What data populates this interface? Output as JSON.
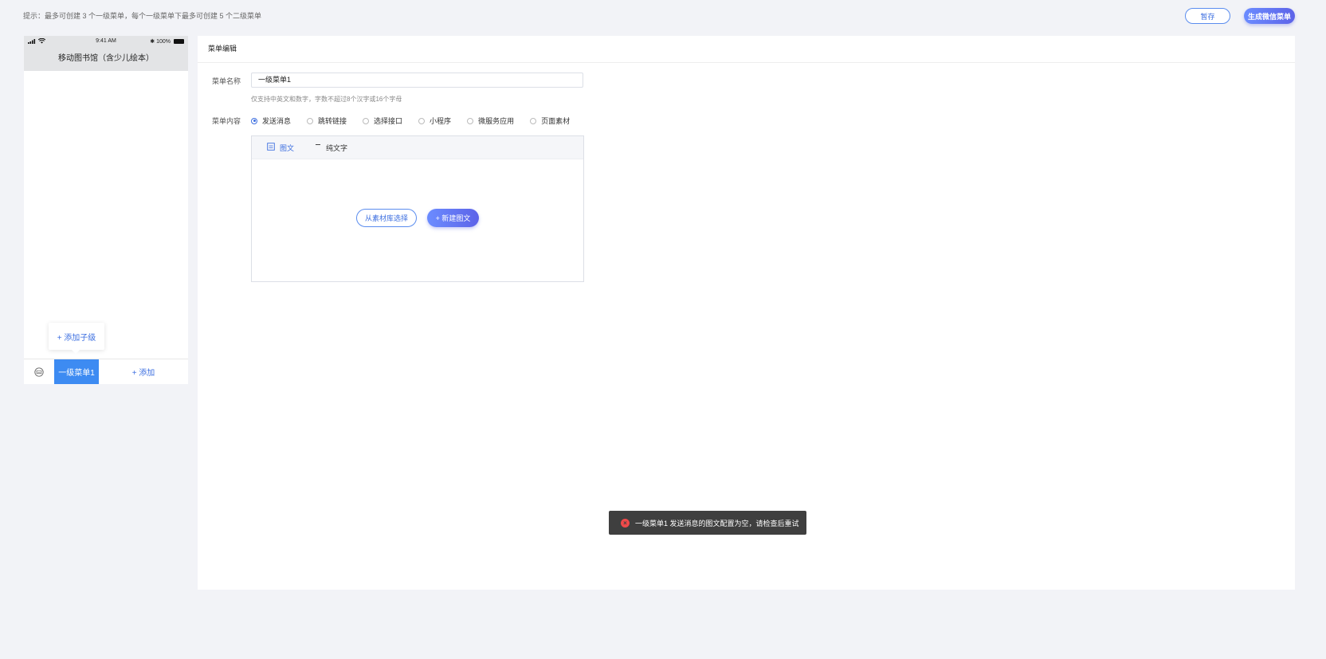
{
  "top": {
    "hint": "提示：最多可创建 3 个一级菜单，每个一级菜单下最多可创建 5 个二级菜单",
    "save_label": "暂存",
    "generate_label": "生成微信菜单"
  },
  "phone": {
    "time": "9:41 AM",
    "battery": "100%",
    "title": "移动图书馆（含少儿绘本）",
    "menu1_label": "一级菜单1",
    "add_label": "+ 添加",
    "add_sub_label": "+ 添加子级"
  },
  "editor": {
    "header": "菜单编辑",
    "name_label": "菜单名称",
    "name_value": "一级菜单1",
    "name_tip": "仅支持中英文和数字，字数不超过8个汉字或16个字母",
    "content_label": "菜单内容",
    "options": [
      "发送消息",
      "跳转链接",
      "选择接口",
      "小程序",
      "微服务应用",
      "页面素材"
    ],
    "selected_option": "发送消息",
    "tabs": [
      "图文",
      "纯文字"
    ],
    "pick_label": "从素材库选择",
    "new_label": "+ 新建图文"
  },
  "toast": {
    "message": "一级菜单1 发送消息的图文配置为空，请检查后重试"
  },
  "colors": {
    "accent": "#3d6fe0",
    "menu_active": "#3d8bf2",
    "toast_bg": "#3f3f3f",
    "error": "#f04a4a"
  }
}
